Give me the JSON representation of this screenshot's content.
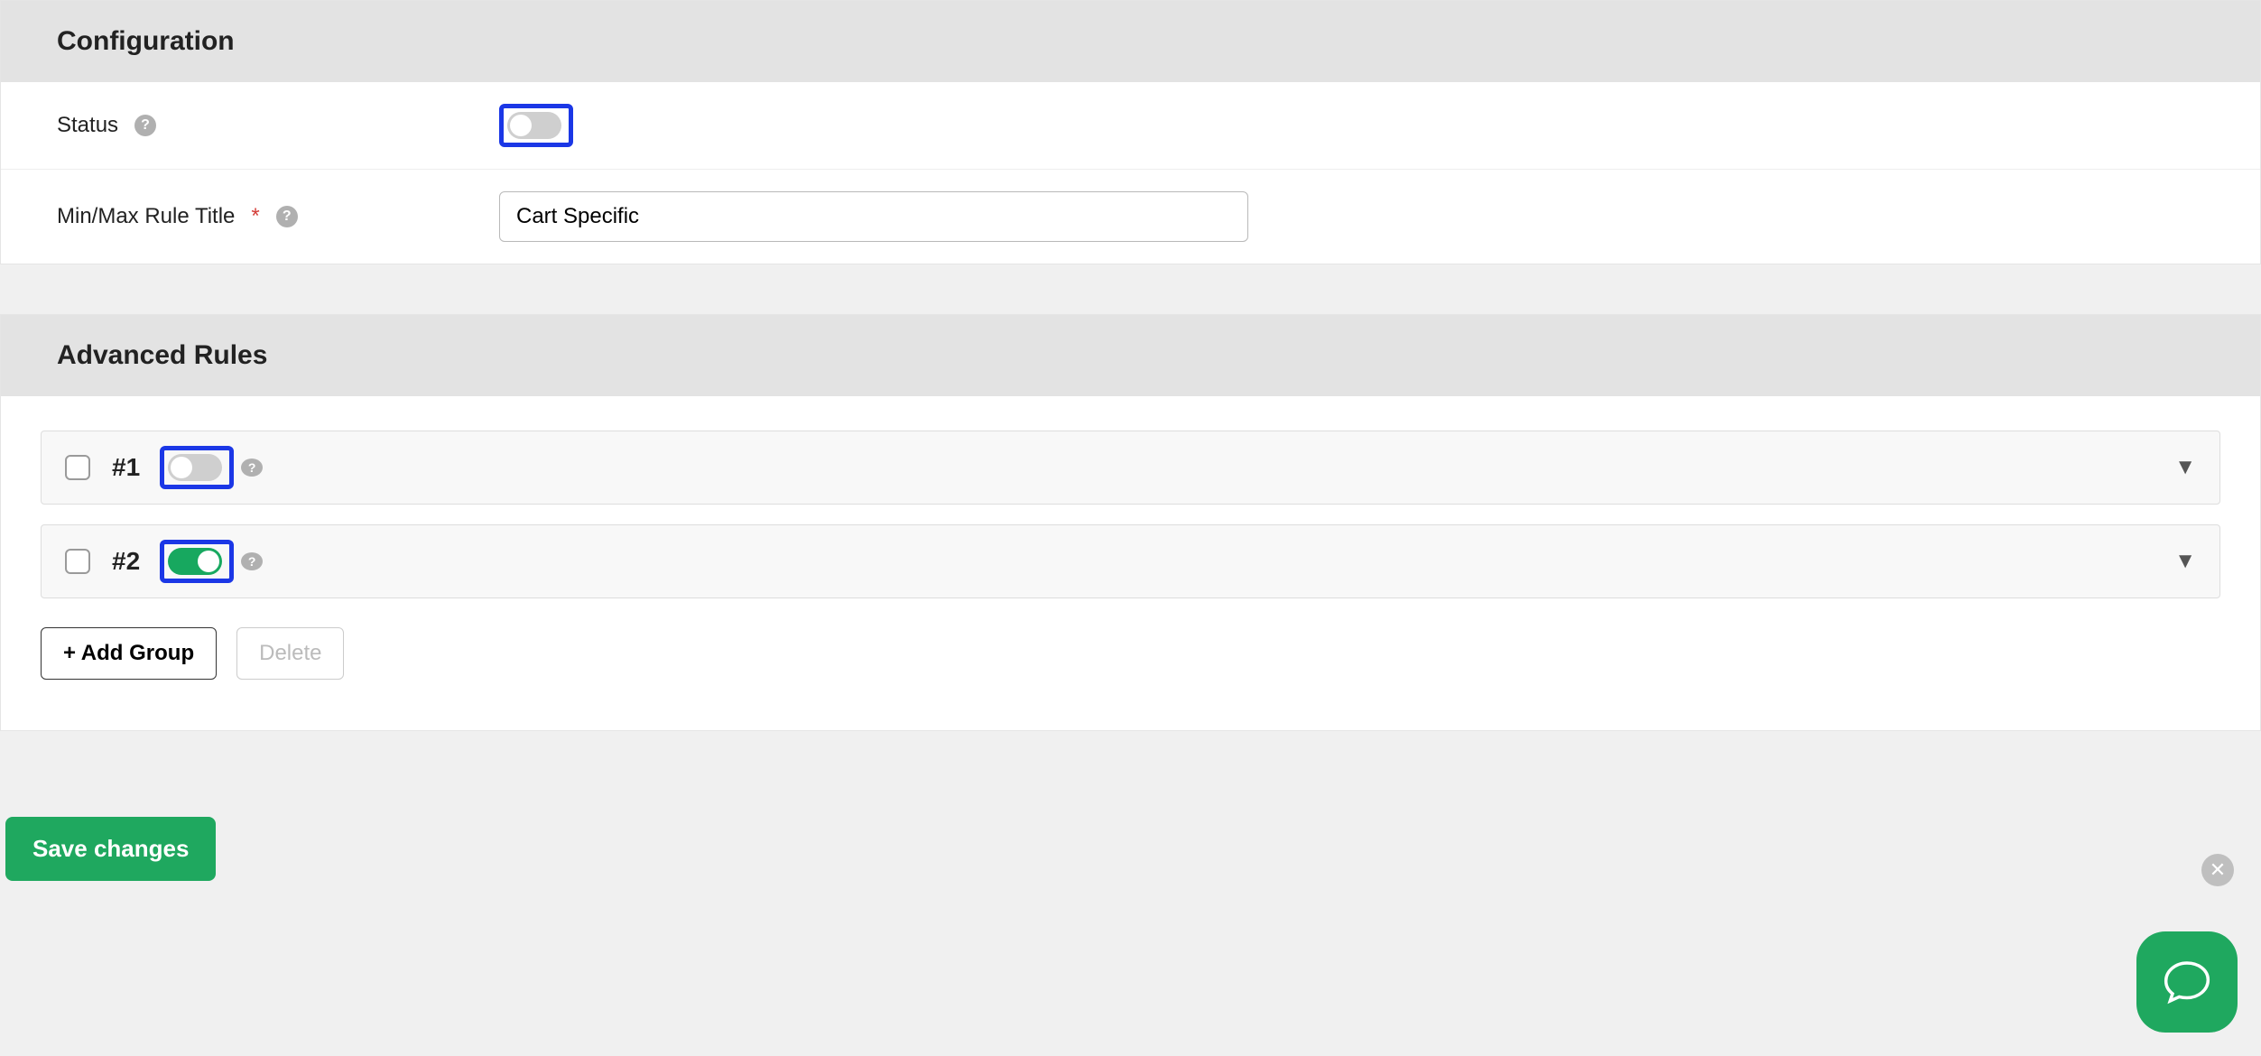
{
  "configuration": {
    "header": "Configuration",
    "status_label": "Status",
    "status_toggle_on": false,
    "title_label": "Min/Max Rule Title",
    "title_value": "Cart Specific"
  },
  "advanced_rules": {
    "header": "Advanced Rules",
    "rules": [
      {
        "num": "#1",
        "checked": false,
        "toggle_on": false
      },
      {
        "num": "#2",
        "checked": false,
        "toggle_on": true
      }
    ],
    "add_group_label": "+ Add Group",
    "delete_label": "Delete"
  },
  "save_label": "Save changes"
}
